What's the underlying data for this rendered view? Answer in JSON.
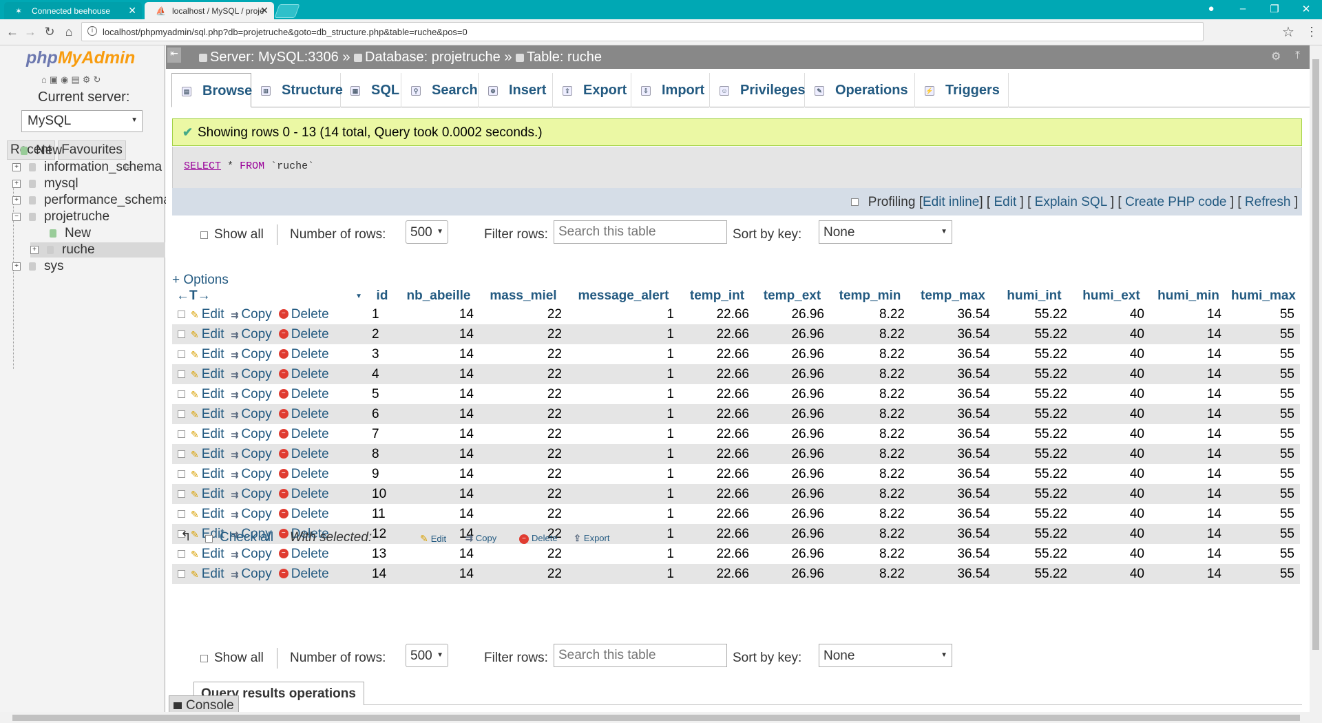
{
  "browser": {
    "tabs": [
      {
        "title": "Connected beehouse",
        "active": false
      },
      {
        "title": "localhost / MySQL / projé",
        "active": true
      }
    ],
    "url": "localhost/phpmyadmin/sql.php?db=projetruche&goto=db_structure.php&table=ruche&pos=0",
    "accent": "#00a8b4"
  },
  "nav": {
    "logo_php": "php",
    "logo_myadmin": "MyAdmin",
    "current_server_label": "Current server:",
    "server_selected": "MySQL",
    "tab_recent": "Recent",
    "tab_favourites": "Favourites",
    "tree": [
      {
        "label": "New",
        "kind": "new"
      },
      {
        "label": "information_schema",
        "kind": "db"
      },
      {
        "label": "mysql",
        "kind": "db"
      },
      {
        "label": "performance_schema",
        "kind": "db"
      },
      {
        "label": "projetruche",
        "kind": "db-open"
      },
      {
        "label": "New",
        "kind": "child-new"
      },
      {
        "label": "ruche",
        "kind": "child-table"
      },
      {
        "label": "sys",
        "kind": "db"
      }
    ]
  },
  "breadcrumb": {
    "server": "Server: MySQL:3306",
    "database": "Database: projetruche",
    "table": "Table: ruche",
    "sep": "»"
  },
  "tabs": [
    "Browse",
    "Structure",
    "SQL",
    "Search",
    "Insert",
    "Export",
    "Import",
    "Privileges",
    "Operations",
    "Triggers"
  ],
  "success_message": "Showing rows 0 - 13 (14 total, Query took 0.0002 seconds.)",
  "sql": {
    "select": "SELECT",
    "star": "*",
    "from": "FROM",
    "table": "`ruche`"
  },
  "actions": {
    "profiling": "Profiling",
    "edit_inline": "Edit inline",
    "edit": "Edit",
    "explain": "Explain SQL",
    "create_php": "Create PHP code",
    "refresh": "Refresh"
  },
  "navrow": {
    "show_all": "Show all",
    "num_rows_label": "Number of rows:",
    "num_rows_value": "500",
    "filter_label": "Filter rows:",
    "filter_placeholder": "Search this table",
    "sort_label": "Sort by key:",
    "sort_value": "None"
  },
  "options_link": "+ Options",
  "table": {
    "arrows": "←T→",
    "columns": [
      "id",
      "nb_abeille",
      "mass_miel",
      "message_alert",
      "temp_int",
      "temp_ext",
      "temp_min",
      "temp_max",
      "humi_int",
      "humi_ext",
      "humi_min",
      "humi_max"
    ],
    "row_actions": {
      "edit": "Edit",
      "copy": "Copy",
      "delete": "Delete"
    },
    "rows": [
      [
        "1",
        "14",
        "22",
        "1",
        "22.66",
        "26.96",
        "8.22",
        "36.54",
        "55.22",
        "40",
        "14",
        "55"
      ],
      [
        "2",
        "14",
        "22",
        "1",
        "22.66",
        "26.96",
        "8.22",
        "36.54",
        "55.22",
        "40",
        "14",
        "55"
      ],
      [
        "3",
        "14",
        "22",
        "1",
        "22.66",
        "26.96",
        "8.22",
        "36.54",
        "55.22",
        "40",
        "14",
        "55"
      ],
      [
        "4",
        "14",
        "22",
        "1",
        "22.66",
        "26.96",
        "8.22",
        "36.54",
        "55.22",
        "40",
        "14",
        "55"
      ],
      [
        "5",
        "14",
        "22",
        "1",
        "22.66",
        "26.96",
        "8.22",
        "36.54",
        "55.22",
        "40",
        "14",
        "55"
      ],
      [
        "6",
        "14",
        "22",
        "1",
        "22.66",
        "26.96",
        "8.22",
        "36.54",
        "55.22",
        "40",
        "14",
        "55"
      ],
      [
        "7",
        "14",
        "22",
        "1",
        "22.66",
        "26.96",
        "8.22",
        "36.54",
        "55.22",
        "40",
        "14",
        "55"
      ],
      [
        "8",
        "14",
        "22",
        "1",
        "22.66",
        "26.96",
        "8.22",
        "36.54",
        "55.22",
        "40",
        "14",
        "55"
      ],
      [
        "9",
        "14",
        "22",
        "1",
        "22.66",
        "26.96",
        "8.22",
        "36.54",
        "55.22",
        "40",
        "14",
        "55"
      ],
      [
        "10",
        "14",
        "22",
        "1",
        "22.66",
        "26.96",
        "8.22",
        "36.54",
        "55.22",
        "40",
        "14",
        "55"
      ],
      [
        "11",
        "14",
        "22",
        "1",
        "22.66",
        "26.96",
        "8.22",
        "36.54",
        "55.22",
        "40",
        "14",
        "55"
      ],
      [
        "12",
        "14",
        "22",
        "1",
        "22.66",
        "26.96",
        "8.22",
        "36.54",
        "55.22",
        "40",
        "14",
        "55"
      ],
      [
        "13",
        "14",
        "22",
        "1",
        "22.66",
        "26.96",
        "8.22",
        "36.54",
        "55.22",
        "40",
        "14",
        "55"
      ],
      [
        "14",
        "14",
        "22",
        "1",
        "22.66",
        "26.96",
        "8.22",
        "36.54",
        "55.22",
        "40",
        "14",
        "55"
      ]
    ]
  },
  "bulk": {
    "check_all": "Check all",
    "with_selected": "With selected:",
    "edit": "Edit",
    "copy": "Copy",
    "delete": "Delete",
    "export": "Export"
  },
  "query_results_ops": "Query results operations",
  "console": "Console"
}
